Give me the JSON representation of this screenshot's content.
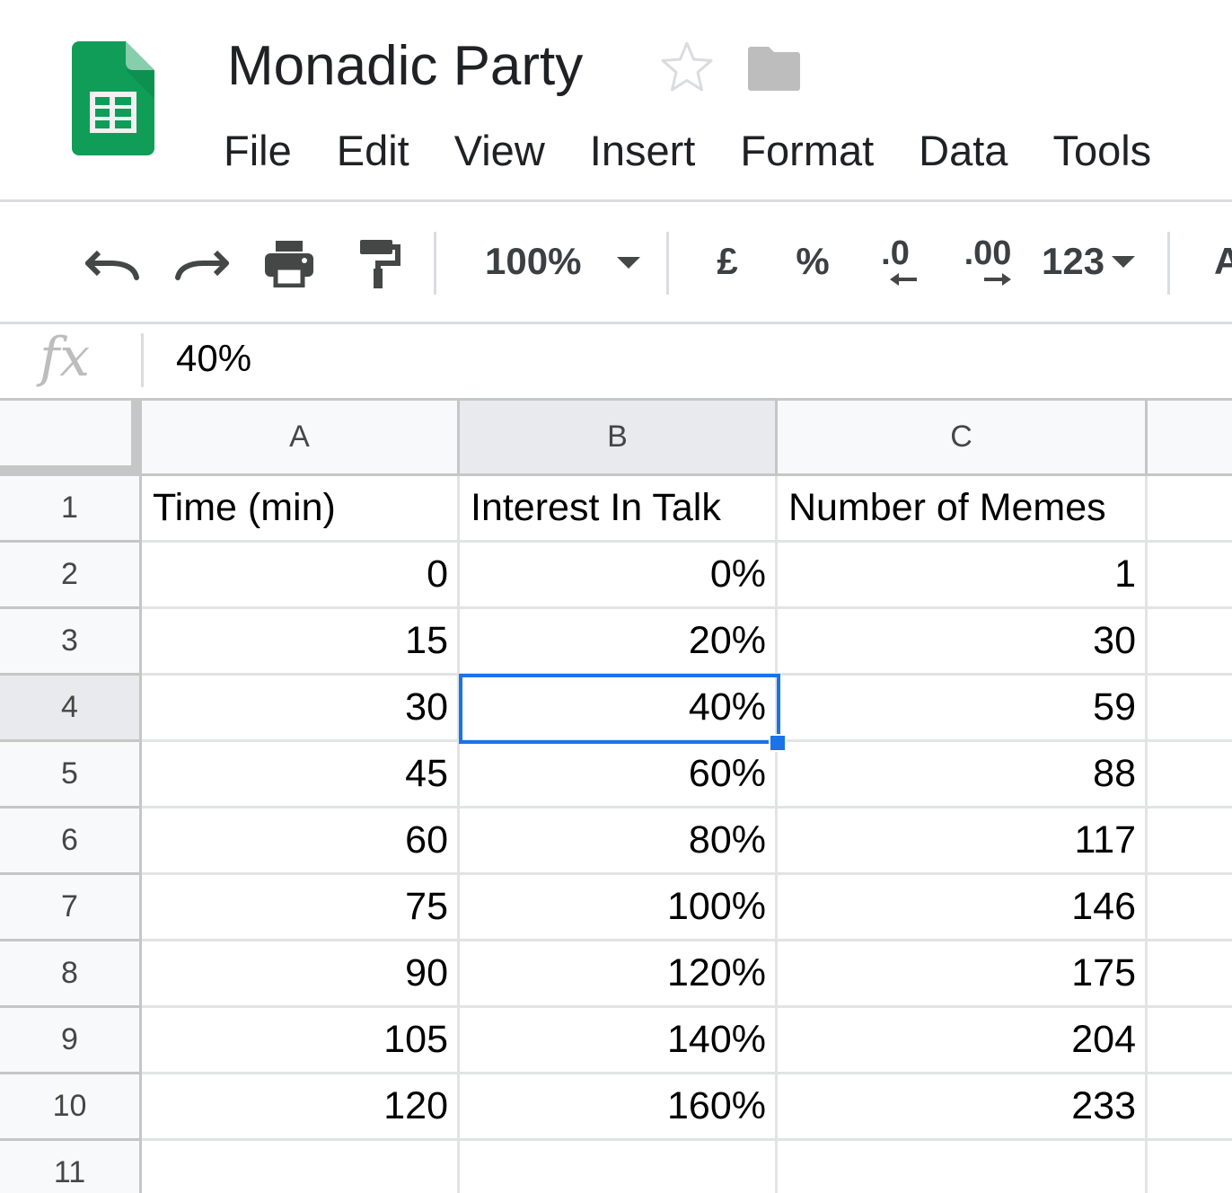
{
  "document": {
    "title": "Monadic Party"
  },
  "menu": [
    "File",
    "Edit",
    "View",
    "Insert",
    "Format",
    "Data",
    "Tools"
  ],
  "toolbar": {
    "zoom": "100%",
    "currency": "£",
    "percent": "%",
    "decrease_decimal": ".0",
    "increase_decimal": ".00",
    "more_formats": "123",
    "next_partial": "A"
  },
  "formula_bar": {
    "fx_label": "fx",
    "value": "40%"
  },
  "columns": [
    "A",
    "B",
    "C"
  ],
  "selected_column": "B",
  "selected_row": "4",
  "rows": [
    {
      "num": "1",
      "cells": [
        {
          "v": "Time (min)",
          "t": "txt"
        },
        {
          "v": "Interest In Talk",
          "t": "txt"
        },
        {
          "v": "Number of Memes",
          "t": "txt"
        }
      ]
    },
    {
      "num": "2",
      "cells": [
        {
          "v": "0",
          "t": "num"
        },
        {
          "v": "0%",
          "t": "num"
        },
        {
          "v": "1",
          "t": "num"
        }
      ]
    },
    {
      "num": "3",
      "cells": [
        {
          "v": "15",
          "t": "num"
        },
        {
          "v": "20%",
          "t": "num"
        },
        {
          "v": "30",
          "t": "num"
        }
      ]
    },
    {
      "num": "4",
      "cells": [
        {
          "v": "30",
          "t": "num"
        },
        {
          "v": "40%",
          "t": "num"
        },
        {
          "v": "59",
          "t": "num"
        }
      ]
    },
    {
      "num": "5",
      "cells": [
        {
          "v": "45",
          "t": "num"
        },
        {
          "v": "60%",
          "t": "num"
        },
        {
          "v": "88",
          "t": "num"
        }
      ]
    },
    {
      "num": "6",
      "cells": [
        {
          "v": "60",
          "t": "num"
        },
        {
          "v": "80%",
          "t": "num"
        },
        {
          "v": "117",
          "t": "num"
        }
      ]
    },
    {
      "num": "7",
      "cells": [
        {
          "v": "75",
          "t": "num"
        },
        {
          "v": "100%",
          "t": "num"
        },
        {
          "v": "146",
          "t": "num"
        }
      ]
    },
    {
      "num": "8",
      "cells": [
        {
          "v": "90",
          "t": "num"
        },
        {
          "v": "120%",
          "t": "num"
        },
        {
          "v": "175",
          "t": "num"
        }
      ]
    },
    {
      "num": "9",
      "cells": [
        {
          "v": "105",
          "t": "num"
        },
        {
          "v": "140%",
          "t": "num"
        },
        {
          "v": "204",
          "t": "num"
        }
      ]
    },
    {
      "num": "10",
      "cells": [
        {
          "v": "120",
          "t": "num"
        },
        {
          "v": "160%",
          "t": "num"
        },
        {
          "v": "233",
          "t": "num"
        }
      ]
    },
    {
      "num": "11",
      "cells": [
        {
          "v": "",
          "t": "num"
        },
        {
          "v": "",
          "t": "num"
        },
        {
          "v": "",
          "t": "num"
        }
      ]
    }
  ],
  "colors": {
    "accent": "#1a73e8",
    "sheets_green": "#0f9d58",
    "header_bg": "#f8f9fa",
    "header_selected_bg": "#e8eaed"
  }
}
